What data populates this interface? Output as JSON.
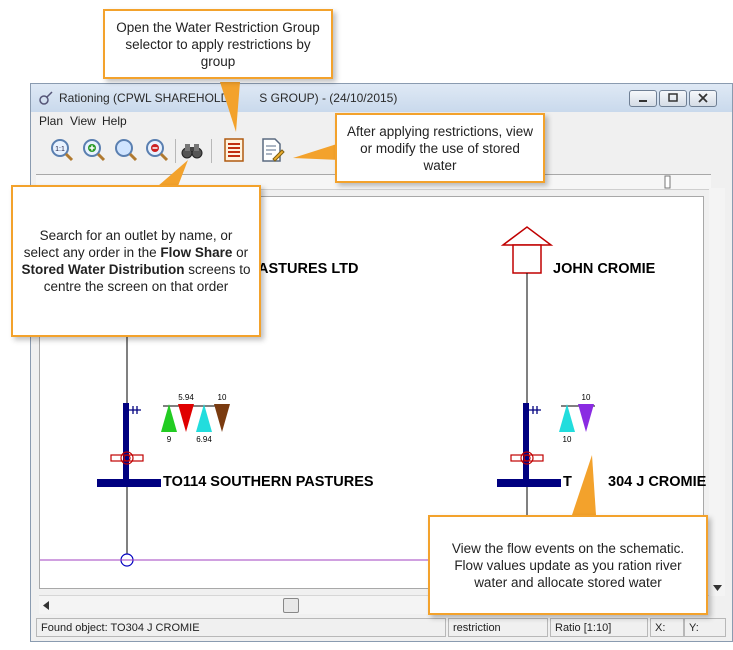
{
  "window": {
    "title": "Rationing (CPWL SHAREHOLD",
    "title_tail": "S GROUP) - (24/10/2015)",
    "menu": [
      "Plan",
      "View",
      "Help"
    ]
  },
  "toolbar": {
    "zoom_actual_label": "1:1"
  },
  "schematic": {
    "owner_left": "ASTURES LTD",
    "owner_right": "JOHN CROMIE",
    "outlet_left": "TO114 SOUTHERN PASTURES",
    "outlet_right_prefix": "T",
    "outlet_right_suffix": "304 J CROMIE",
    "flags_left": [
      "9",
      "5.94",
      "6.94",
      "10"
    ],
    "flags_right": [
      "10",
      "10"
    ]
  },
  "status": {
    "message": "Found object: TO304 J CROMIE",
    "mode": "restriction",
    "ratio": "Ratio [1:10]",
    "x_label": "X:",
    "y_label": "Y:"
  },
  "callouts": {
    "group_selector": "Open the Water Restriction Group selector to apply restrictions by group",
    "stored_water": "After applying restrictions, view or modify the use of stored water",
    "search": {
      "part1": "Search for an outlet by name, or select any order in the",
      "bold1": "Flow Share",
      "part2": "or",
      "bold2": "Stored Water Distribution",
      "part3": "screens to centre the screen on that order"
    },
    "flow_events": "View the flow events on the schematic. Flow values update as you ration river water and allocate stored water"
  },
  "colors": {
    "callout_border": "#f3a22c",
    "pipe": "#000080",
    "valve": "#c00000",
    "house": "#c00000",
    "boundary_line": "#a040c0",
    "flag_green": "#22cc22",
    "flag_red": "#e00000",
    "flag_cyan": "#22dddd",
    "flag_brown": "#7a3b10",
    "flag_purple": "#8a2be2"
  }
}
